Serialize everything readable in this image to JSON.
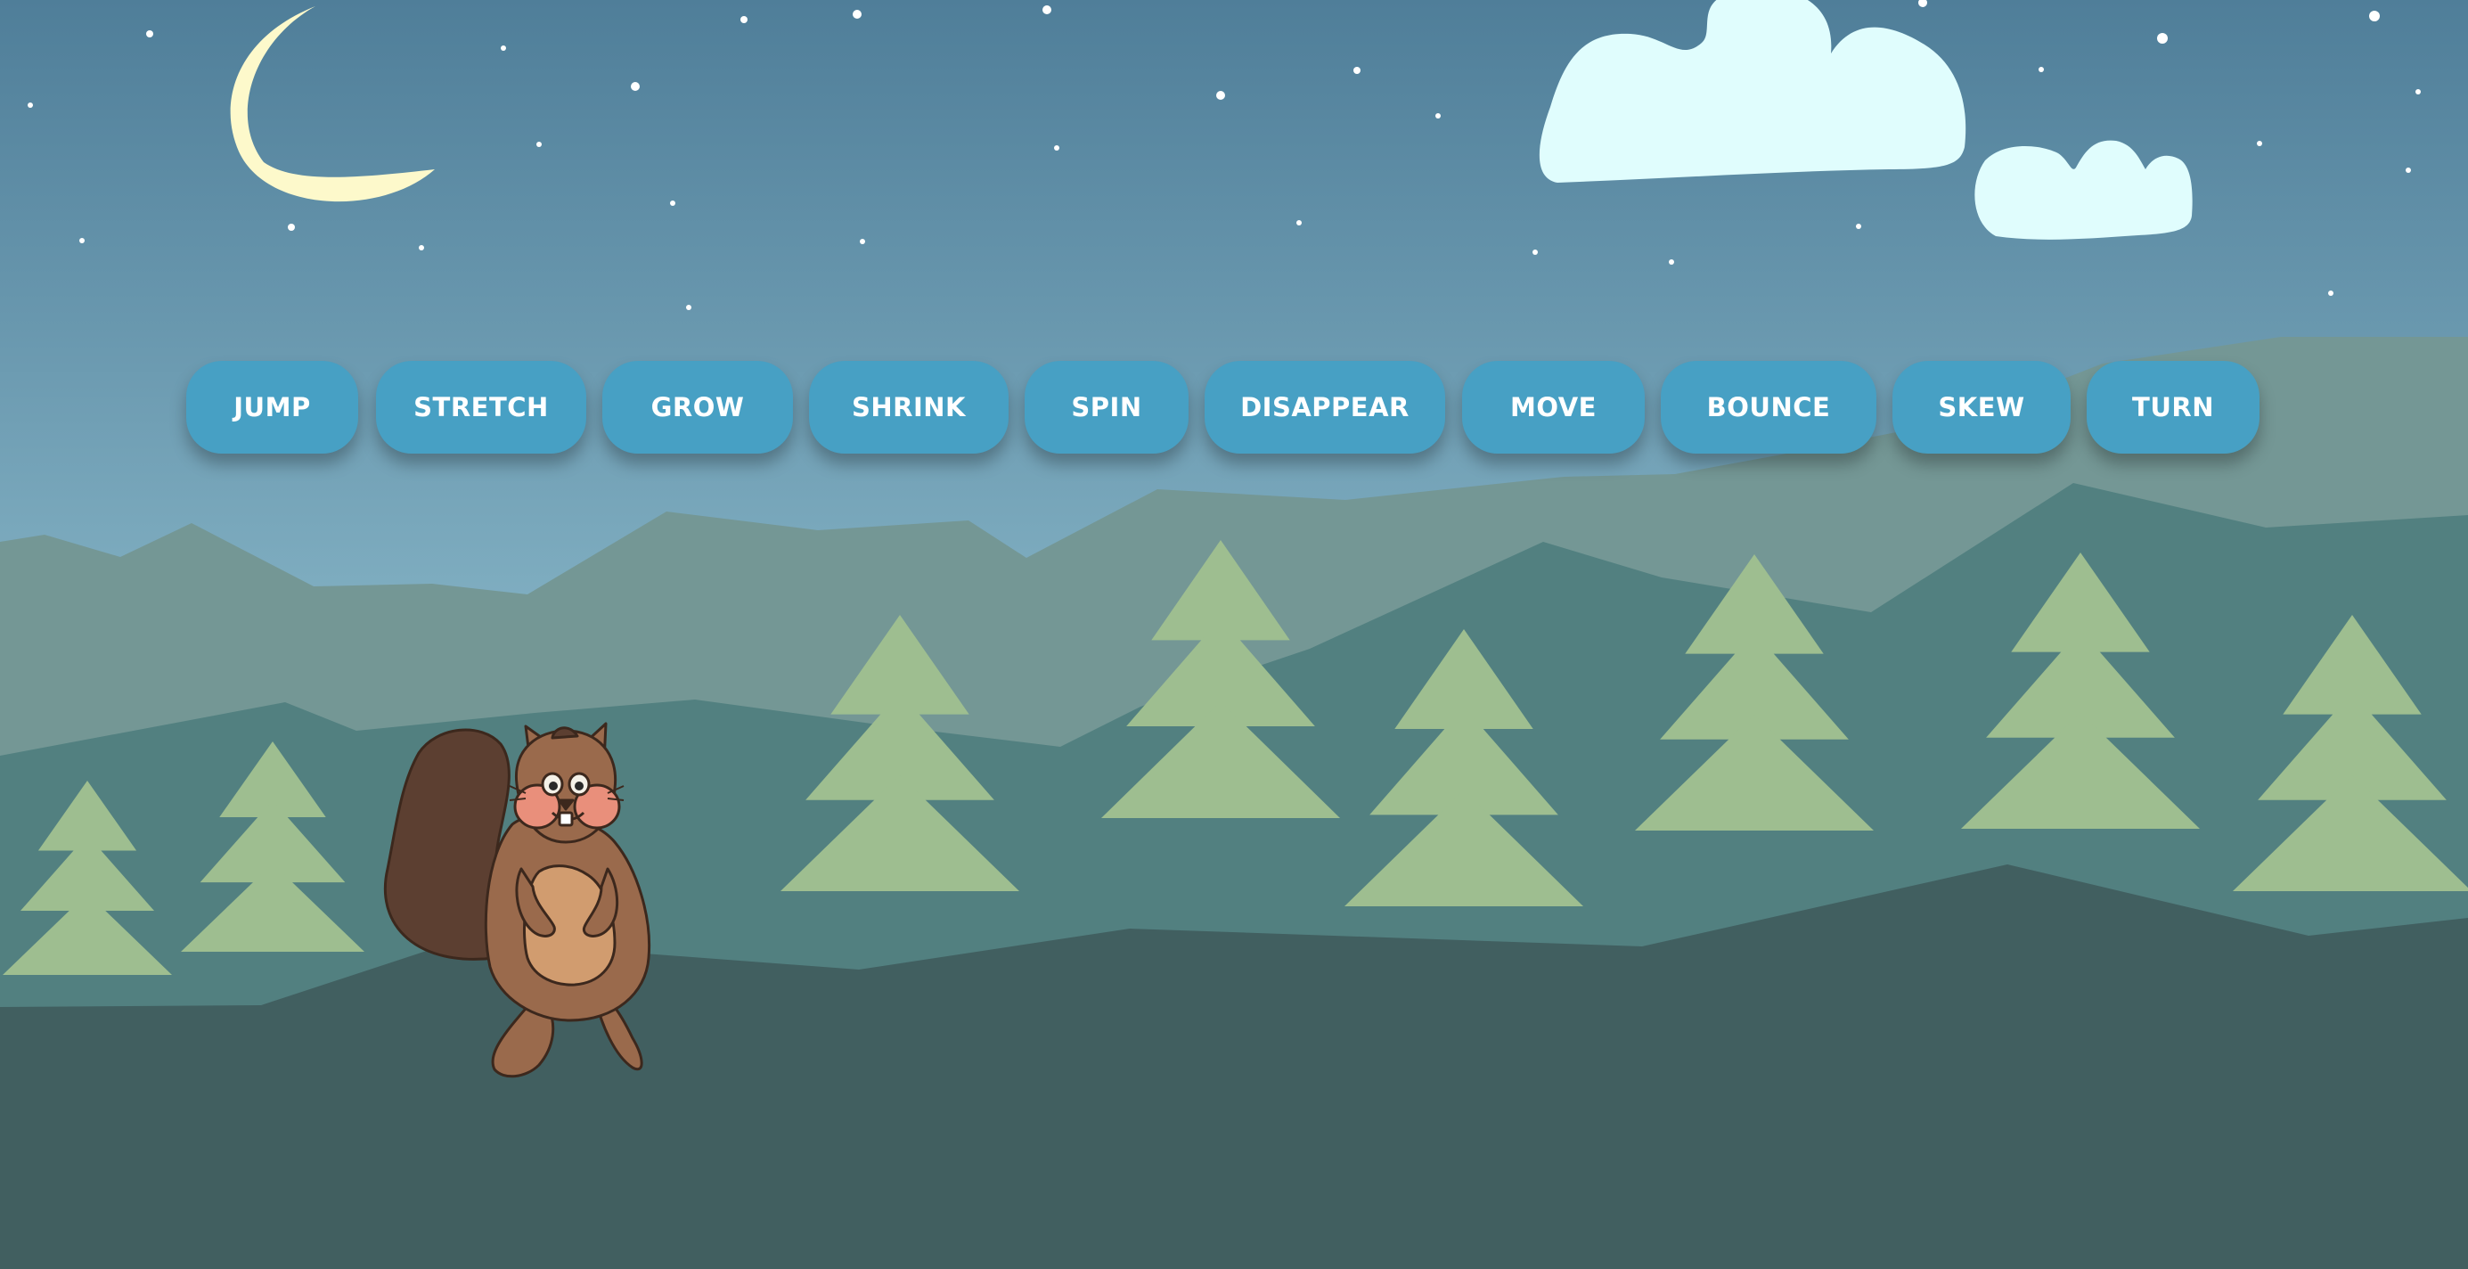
{
  "colors": {
    "sky_top": "#4f7e99",
    "sky_bottom": "#b4e2ec",
    "moon": "#fdf9cb",
    "cloud": "#e0fdfd",
    "star": "#ffffff",
    "mountain_back": "#749795",
    "mountain_mid": "#528080",
    "ground": "#415f60",
    "tree": "#9ebe90",
    "button_bg": "#47a0c4",
    "button_text": "#ffffff",
    "squirrel_tail": "#5c3f31",
    "squirrel_body": "#9a6a4c",
    "squirrel_belly": "#d19c6f",
    "squirrel_cheek": "#e98f7b"
  },
  "buttons": [
    {
      "label": "JUMP"
    },
    {
      "label": "STRETCH"
    },
    {
      "label": "GROW"
    },
    {
      "label": "SHRINK"
    },
    {
      "label": "SPIN"
    },
    {
      "label": "DISAPPEAR"
    },
    {
      "label": "MOVE"
    },
    {
      "label": "BOUNCE"
    },
    {
      "label": "SKEW"
    },
    {
      "label": "TURN"
    }
  ],
  "character": "squirrel",
  "icons": [
    "moon-icon",
    "cloud-icon",
    "star-icon",
    "tree-icon",
    "squirrel-character"
  ]
}
